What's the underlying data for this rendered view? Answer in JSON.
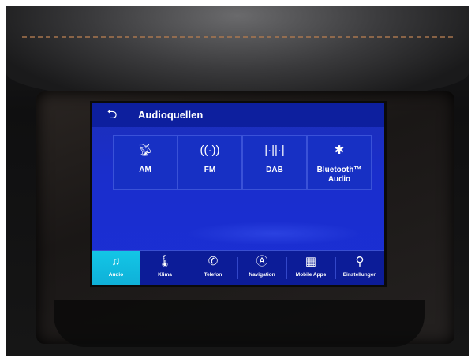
{
  "header": {
    "back_icon": "back-arrow-icon",
    "title": "Audioquellen"
  },
  "sources": [
    {
      "label": "AM",
      "icon": "antenna-icon"
    },
    {
      "label": "FM",
      "icon": "radio-wave-icon"
    },
    {
      "label": "DAB",
      "icon": "signal-bars-icon"
    },
    {
      "label": "Bluetooth™\nAudio",
      "icon": "bluetooth-icon"
    }
  ],
  "nav": [
    {
      "label": "Audio",
      "icon": "music-note-icon",
      "active": true
    },
    {
      "label": "Klima",
      "icon": "thermometer-icon",
      "active": false
    },
    {
      "label": "Telefon",
      "icon": "phone-icon",
      "active": false
    },
    {
      "label": "Navigation",
      "icon": "navigation-icon",
      "active": false
    },
    {
      "label": "Mobile Apps",
      "icon": "grid-icon",
      "active": false
    },
    {
      "label": "Einstellungen",
      "icon": "settings-icon",
      "active": false
    }
  ],
  "colors": {
    "screen_blue": "#1b2fd6",
    "header_blue": "#0d1f9e",
    "active_cyan": "#13c6e6"
  }
}
